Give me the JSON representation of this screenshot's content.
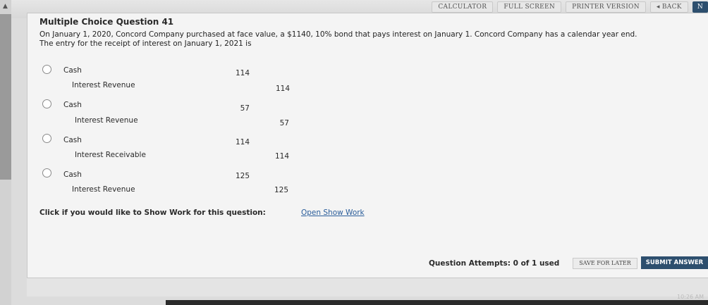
{
  "toolbar": {
    "calculator": "CALCULATOR",
    "full_screen": "FULL SCREEN",
    "printer_version": "PRINTER VERSION",
    "back": "◂ BACK",
    "next": "N"
  },
  "question": {
    "title": "Multiple Choice Question 41",
    "text_line1": "On January 1, 2020, Concord Company purchased at face value, a $1140, 10% bond that pays interest on January 1. Concord Company has a calendar year end.",
    "text_line2": "The entry for the receipt of interest on January 1, 2021 is"
  },
  "options": [
    {
      "debit_account": "Cash",
      "debit_amount": "114",
      "credit_account": "Interest Revenue",
      "credit_amount": "114"
    },
    {
      "debit_account": "Cash",
      "debit_amount": "57",
      "credit_account": "Interest Revenue",
      "credit_amount": "57"
    },
    {
      "debit_account": "Cash",
      "debit_amount": "114",
      "credit_account": "Interest Receivable",
      "credit_amount": "114"
    },
    {
      "debit_account": "Cash",
      "debit_amount": "125",
      "credit_account": "Interest Revenue",
      "credit_amount": "125"
    }
  ],
  "show_work": {
    "prompt": "Click if you would like to Show Work for this question:",
    "link": "Open Show Work"
  },
  "footer": {
    "attempts": "Question Attempts: 0 of 1 used",
    "save_label": "SAVE FOR LATER",
    "submit_label": "SUBMIT ANSWER"
  },
  "clock": "10:26 AM"
}
